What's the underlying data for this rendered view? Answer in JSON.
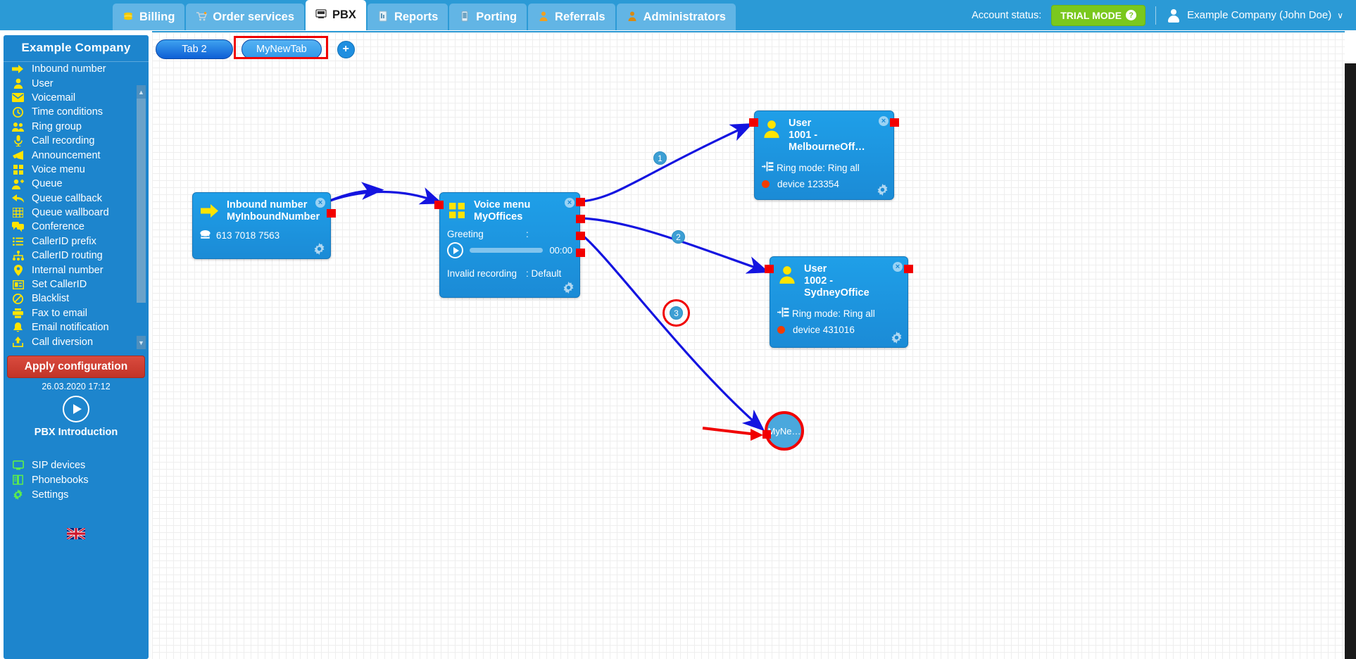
{
  "topnav": {
    "tabs": [
      {
        "label": "Billing",
        "icon": "coins-icon",
        "active": false
      },
      {
        "label": "Order services",
        "icon": "cart-icon",
        "active": false
      },
      {
        "label": "PBX",
        "icon": "pbx-icon",
        "active": true
      },
      {
        "label": "Reports",
        "icon": "report-icon",
        "active": false
      },
      {
        "label": "Porting",
        "icon": "mobile-icon",
        "active": false
      },
      {
        "label": "Referrals",
        "icon": "person-icon",
        "active": false
      },
      {
        "label": "Administrators",
        "icon": "admin-icon",
        "active": false
      }
    ],
    "account_status_label": "Account status:",
    "trial_badge": "TRIAL MODE",
    "trial_badge_help": "?",
    "account_name": "Example Company (John Doe)",
    "account_caret": "∨"
  },
  "sidebar": {
    "title": "Example Company",
    "items": [
      {
        "label": "Inbound number",
        "icon": "arrow-right-icon"
      },
      {
        "label": "User",
        "icon": "person-icon"
      },
      {
        "label": "Voicemail",
        "icon": "envelope-icon"
      },
      {
        "label": "Time conditions",
        "icon": "clock-icon"
      },
      {
        "label": "Ring group",
        "icon": "people-icon"
      },
      {
        "label": "Call recording",
        "icon": "microphone-icon"
      },
      {
        "label": "Announcement",
        "icon": "megaphone-icon"
      },
      {
        "label": "Voice menu",
        "icon": "grid-squares-icon"
      },
      {
        "label": "Queue",
        "icon": "person-plus-icon"
      },
      {
        "label": "Queue callback",
        "icon": "arrow-back-icon"
      },
      {
        "label": "Queue wallboard",
        "icon": "table-icon"
      },
      {
        "label": "Conference",
        "icon": "chat-bubbles-icon"
      },
      {
        "label": "CallerID prefix",
        "icon": "list-icon"
      },
      {
        "label": "CallerID routing",
        "icon": "sitemap-icon"
      },
      {
        "label": "Internal number",
        "icon": "pin-icon"
      },
      {
        "label": "Set CallerID",
        "icon": "id-card-icon"
      },
      {
        "label": "Blacklist",
        "icon": "ban-icon"
      },
      {
        "label": "Fax to email",
        "icon": "printer-icon"
      },
      {
        "label": "Email notification",
        "icon": "bell-icon"
      },
      {
        "label": "Call diversion",
        "icon": "upload-icon"
      }
    ],
    "apply_button": "Apply configuration",
    "apply_timestamp": "26.03.2020 17:12",
    "intro_label": "PBX Introduction",
    "bottom_items": [
      {
        "label": "SIP devices",
        "icon": "monitor-icon"
      },
      {
        "label": "Phonebooks",
        "icon": "book-icon"
      },
      {
        "label": "Settings",
        "icon": "gear-icon"
      }
    ],
    "language_flag": "uk-flag-icon"
  },
  "flow": {
    "tabs": [
      {
        "label": "Tab 2",
        "selected": false,
        "highlighted": false
      },
      {
        "label": "MyNewTab",
        "selected": true,
        "highlighted": true
      }
    ],
    "add_tab_label": "+",
    "nodes": [
      {
        "id": "inbound",
        "type": "Inbound number",
        "icon": "arrow-right-icon",
        "title": "Inbound number",
        "name": "MyInboundNumber",
        "phone_icon": "telephone-icon",
        "phone": "613 7018 7563",
        "close_label": "×",
        "gear_icon": "gear-icon"
      },
      {
        "id": "voicemenu",
        "type": "Voice menu",
        "icon": "grid-squares-icon",
        "title": "Voice menu",
        "name": "MyOffices",
        "greeting_label": "Greeting",
        "greeting_sep": ":",
        "greeting_value": "",
        "player_time": "00:00",
        "invalid_label": "Invalid recording",
        "invalid_value": ": Default",
        "close_label": "×",
        "gear_icon": "gear-icon"
      },
      {
        "id": "user1",
        "type": "User",
        "icon": "person-icon",
        "title": "User",
        "name": "1001 - MelbourneOff…",
        "ring_mode": "Ring mode: Ring all",
        "ring_icon": "ring-mode-icon",
        "device_status_icon": "red-dot-icon",
        "device": "device 123354",
        "close_label": "×",
        "gear_icon": "gear-icon"
      },
      {
        "id": "user2",
        "type": "User",
        "icon": "person-icon",
        "title": "User",
        "name": "1002 - SydneyOffice",
        "ring_mode": "Ring mode: Ring all",
        "ring_icon": "ring-mode-icon",
        "device_status_icon": "red-dot-icon",
        "device": "device 431016",
        "close_label": "×",
        "gear_icon": "gear-icon"
      },
      {
        "id": "circle",
        "type": "new-node",
        "label": "MyNe…",
        "highlighted": true
      }
    ],
    "connection_badges": [
      {
        "id": "b1",
        "label": "1",
        "highlighted": false
      },
      {
        "id": "b2",
        "label": "2",
        "highlighted": false
      },
      {
        "id": "b3",
        "label": "3",
        "highlighted": true
      }
    ]
  },
  "colors": {
    "nav_blue": "#2b9ad6",
    "nav_tab_blue": "#62b5e5",
    "sidebar_blue": "#1d85cd",
    "node_blue": "#1b8bd6",
    "accent_yellow": "#ffe400",
    "accent_green": "#5ced4c",
    "trial_green": "#7ac81e",
    "apply_red": "#c23428",
    "highlight_red": "#f00000",
    "wire_blue": "#1414e0",
    "port_red": "#f20000"
  }
}
